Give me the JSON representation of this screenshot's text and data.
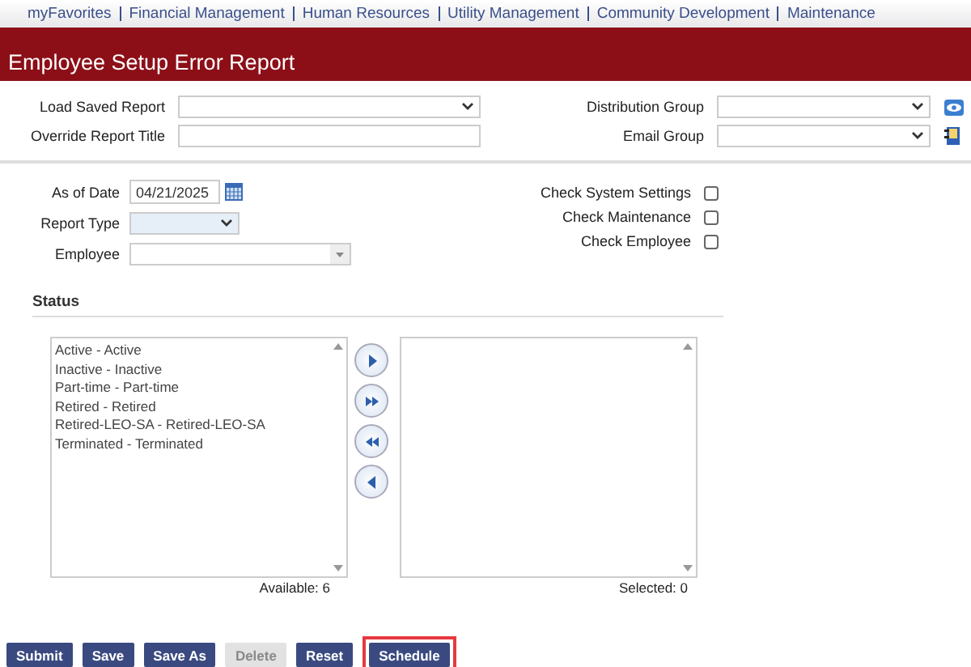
{
  "nav": [
    "myFavorites",
    "Financial Management",
    "Human Resources",
    "Utility Management",
    "Community Development",
    "Maintenance"
  ],
  "title": "Employee Setup Error Report",
  "top_fields": {
    "load_saved_report": {
      "label": "Load Saved Report"
    },
    "override_report_title": {
      "label": "Override Report Title"
    },
    "distribution_group": {
      "label": "Distribution Group"
    },
    "email_group": {
      "label": "Email Group"
    }
  },
  "as_of_date": {
    "label": "As of Date",
    "value": "04/21/2025"
  },
  "report_type": {
    "label": "Report Type"
  },
  "employee": {
    "label": "Employee",
    "disabled": true
  },
  "checks": [
    {
      "label": "Check System Settings",
      "checked": false
    },
    {
      "label": "Check Maintenance",
      "checked": false
    },
    {
      "label": "Check Employee",
      "checked": false
    }
  ],
  "status": {
    "heading": "Status",
    "available": [
      "Active - Active",
      "Inactive - Inactive",
      "Part-time - Part-time",
      "Retired - Retired",
      "Retired-LEO-SA - Retired-LEO-SA",
      "Terminated - Terminated"
    ],
    "available_count": "Available: 6",
    "selected_count": "Selected: 0"
  },
  "buttons": [
    {
      "label": "Submit",
      "disabled": false,
      "highlighted": false
    },
    {
      "label": "Save",
      "disabled": false,
      "highlighted": false
    },
    {
      "label": "Save As",
      "disabled": false,
      "highlighted": false
    },
    {
      "label": "Delete",
      "disabled": true,
      "highlighted": false
    },
    {
      "label": "Reset",
      "disabled": false,
      "highlighted": false
    },
    {
      "label": "Schedule",
      "disabled": false,
      "highlighted": true
    }
  ]
}
